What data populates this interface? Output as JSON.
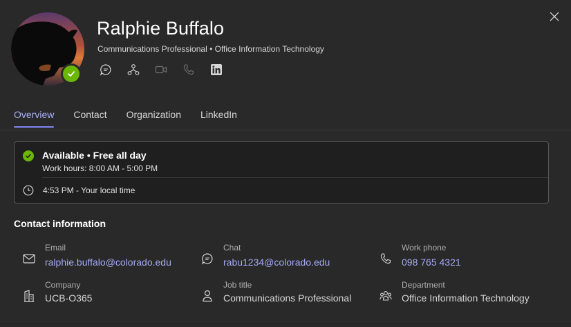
{
  "profile": {
    "name": "Ralphie Buffalo",
    "subtitle": "Communications Professional • Office Information Technology"
  },
  "actions": [
    {
      "icon": "chat-icon",
      "enabled": true
    },
    {
      "icon": "org-chart-icon",
      "enabled": true
    },
    {
      "icon": "video-call-icon",
      "enabled": false
    },
    {
      "icon": "phone-call-icon",
      "enabled": false
    },
    {
      "icon": "linkedin-icon",
      "enabled": true
    }
  ],
  "tabs": [
    {
      "label": "Overview",
      "active": true
    },
    {
      "label": "Contact",
      "active": false
    },
    {
      "label": "Organization",
      "active": false
    },
    {
      "label": "LinkedIn",
      "active": false
    }
  ],
  "status": {
    "main": "Available • Free all day",
    "hours": "Work hours: 8:00 AM - 5:00 PM",
    "local_time": "4:53 PM - Your local time"
  },
  "contact": {
    "title": "Contact information",
    "email_label": "Email",
    "email_value": "ralphie.buffalo@colorado.edu",
    "chat_label": "Chat",
    "chat_value": "rabu1234@colorado.edu",
    "phone_label": "Work phone",
    "phone_value": "098 765 4321",
    "company_label": "Company",
    "company_value": "UCB-O365",
    "job_label": "Job title",
    "job_value": "Communications Professional",
    "dept_label": "Department",
    "dept_value": "Office Information Technology"
  },
  "colors": {
    "background": "#292929",
    "accent": "#7f85f5",
    "link": "#a4a9f5",
    "available": "#6bb700"
  }
}
